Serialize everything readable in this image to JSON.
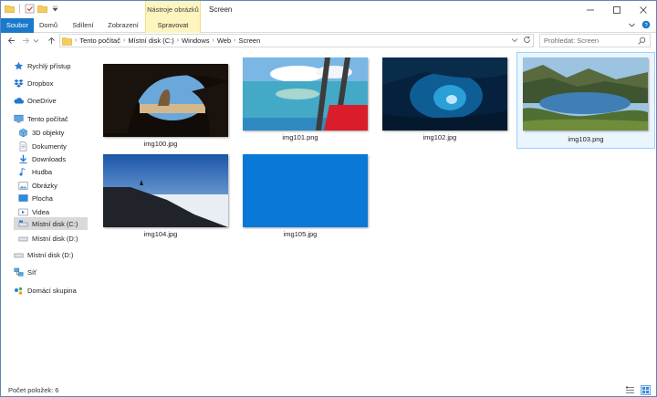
{
  "window": {
    "title": "Screen",
    "context_group": "Nástroje obrázků"
  },
  "ribbon": {
    "tabs": [
      {
        "label": "Soubor"
      },
      {
        "label": "Domů"
      },
      {
        "label": "Sdílení"
      },
      {
        "label": "Zobrazení"
      },
      {
        "label": "Spravovat"
      }
    ]
  },
  "address": {
    "crumbs": [
      "Tento počítač",
      "Místní disk (C:)",
      "Windows",
      "Web",
      "Screen"
    ]
  },
  "search": {
    "placeholder": "Prohledat: Screen"
  },
  "nav": {
    "items": [
      {
        "label": "Rychlý přístup",
        "icon": "star-icon"
      },
      {
        "label": "Dropbox",
        "icon": "dropbox-icon"
      },
      {
        "label": "OneDrive",
        "icon": "cloud-icon"
      },
      {
        "label": "Tento počítač",
        "icon": "computer-icon"
      },
      {
        "label": "3D objekty",
        "icon": "cube-icon"
      },
      {
        "label": "Dokumenty",
        "icon": "document-icon"
      },
      {
        "label": "Downloads",
        "icon": "download-icon"
      },
      {
        "label": "Hudba",
        "icon": "music-icon"
      },
      {
        "label": "Obrázky",
        "icon": "pictures-icon"
      },
      {
        "label": "Plocha",
        "icon": "desktop-icon"
      },
      {
        "label": "Videa",
        "icon": "video-icon"
      },
      {
        "label": "Místní disk (C:)",
        "icon": "drive-icon"
      },
      {
        "label": "Místní disk (D:)",
        "icon": "drive-icon"
      },
      {
        "label": "Místní disk (D:)",
        "icon": "drive-icon"
      },
      {
        "label": "Síť",
        "icon": "network-icon"
      },
      {
        "label": "Domácí skupina",
        "icon": "homegroup-icon"
      }
    ]
  },
  "files": [
    {
      "name": "img100.jpg"
    },
    {
      "name": "img101.png"
    },
    {
      "name": "img102.jpg"
    },
    {
      "name": "img103.png"
    },
    {
      "name": "img104.jpg"
    },
    {
      "name": "img105.jpg"
    }
  ],
  "status": {
    "count": "Počet položek: 6"
  },
  "colors": {
    "accent": "#1979ca",
    "context_tab": "#fdf4bf",
    "selection": "#eaf5fe"
  }
}
